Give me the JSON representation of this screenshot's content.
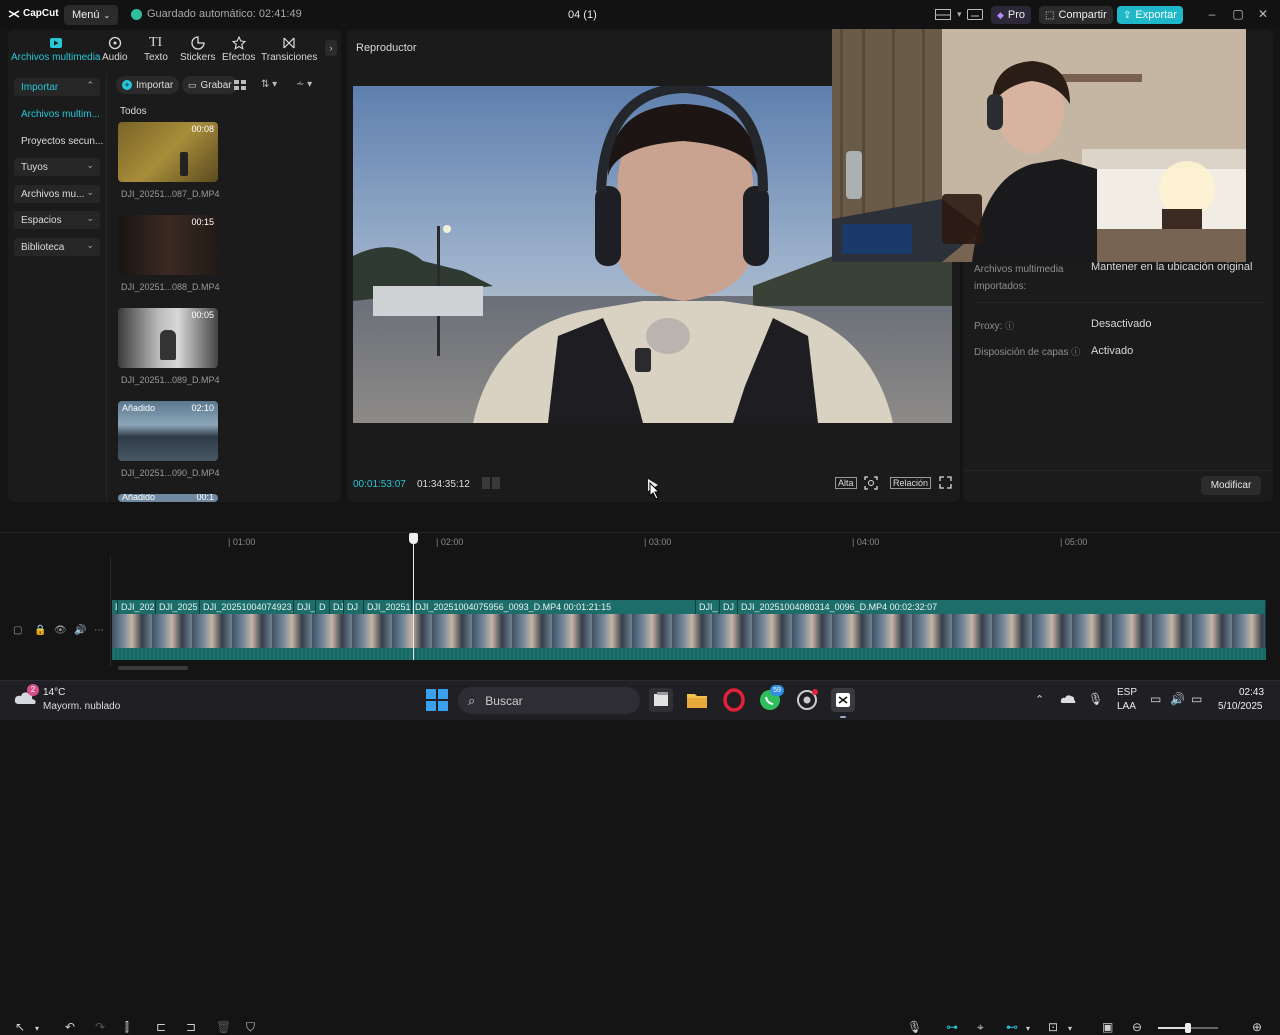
{
  "app": {
    "logo_text": "CapCut",
    "menu_label": "Menú",
    "autosave": "Guardado automático: 02:41:49",
    "project_title": "04 (1)",
    "pro_label": "Pro",
    "share_label": "Compartir",
    "export_label": "Exportar",
    "accent": "#27c7d8"
  },
  "tool_tabs": [
    {
      "label": "Archivos multimedia",
      "icon": "media-icon"
    },
    {
      "label": "Audio",
      "icon": "audio-icon"
    },
    {
      "label": "Texto",
      "icon": "text-icon"
    },
    {
      "label": "Stickers",
      "icon": "sticker-icon"
    },
    {
      "label": "Efectos",
      "icon": "effects-icon"
    },
    {
      "label": "Transiciones",
      "icon": "transitions-icon"
    }
  ],
  "sidebar": {
    "import_label": "Importar",
    "items": [
      {
        "label": "Archivos multim..."
      },
      {
        "label": "Proyectos secun..."
      },
      {
        "label": "Tuyos"
      },
      {
        "label": "Archivos mu..."
      },
      {
        "label": "Espacios"
      },
      {
        "label": "Biblioteca"
      }
    ]
  },
  "media": {
    "import_btn": "Importar",
    "record_btn": "Grabar",
    "filter_label": "Todos",
    "items": [
      {
        "name": "DJI_20251...087_D.MP4",
        "duration": "00:08",
        "badge": ""
      },
      {
        "name": "DJI_20251...088_D.MP4",
        "duration": "00:15",
        "badge": ""
      },
      {
        "name": "DJI_20251...089_D.MP4",
        "duration": "00:05",
        "badge": ""
      },
      {
        "name": "DJI_20251...090_D.MP4",
        "duration": "02:10",
        "badge": "Añadido"
      },
      {
        "name": "",
        "duration": "00:1",
        "badge": "Añadido"
      }
    ]
  },
  "player": {
    "title": "Reproductor",
    "current_time": "00:01:53:07",
    "total_time": "01:34:35:12",
    "quality": "Alta",
    "ratio": "Relación"
  },
  "details": {
    "rows": [
      {
        "label": "Archivos multimedia importados:",
        "value": "Mantener en la ubicación original"
      },
      {
        "label": "Proxy:",
        "value": "Desactivado"
      },
      {
        "label": "Disposición de capas",
        "value": "Activado"
      }
    ],
    "modify_label": "Modificar"
  },
  "timeline": {
    "ruler": [
      "| 01:00",
      "| 02:00",
      "| 03:00",
      "| 04:00",
      "| 05:00"
    ],
    "clips": [
      {
        "label": "D"
      },
      {
        "label": "DJI_202"
      },
      {
        "label": "DJI_2025"
      },
      {
        "label": "DJI_20251004074923_"
      },
      {
        "label": "DJI_"
      },
      {
        "label": "D"
      },
      {
        "label": "DJ"
      },
      {
        "label": "DJI_202510"
      },
      {
        "label": "DJI_20251004075956_0093_D.MP4   00:01:21:15"
      },
      {
        "label": "DJI_"
      },
      {
        "label": "DJ"
      },
      {
        "label": "DJI_20251004080314_0096_D.MP4   00:02:32:07"
      }
    ]
  },
  "taskbar": {
    "weather_temp": "14°C",
    "weather_desc": "Mayorm. nublado",
    "weather_badge": "2",
    "search_label": "Buscar",
    "whatsapp_badge": "59",
    "lang": "ESP",
    "lang_sub": "LAA",
    "time": "02:43",
    "date": "5/10/2025"
  }
}
